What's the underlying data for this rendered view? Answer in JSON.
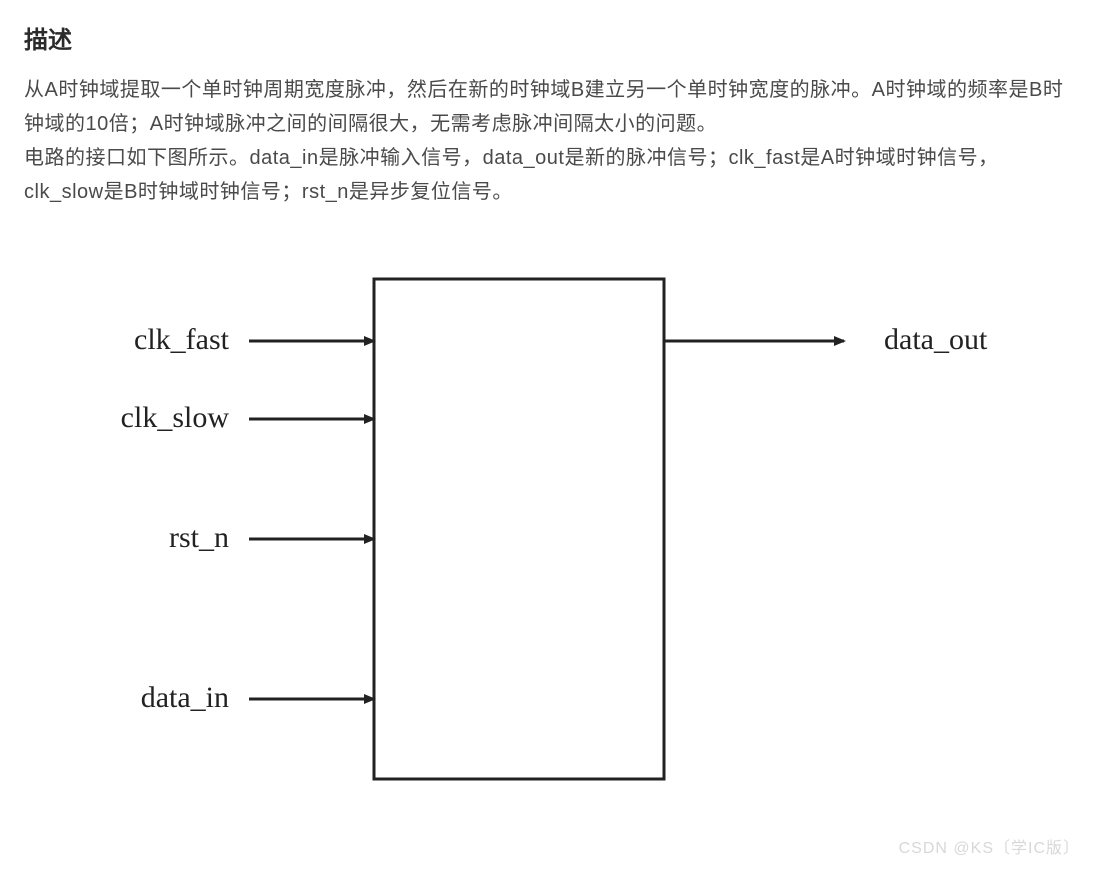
{
  "heading": "描述",
  "paragraph": "从A时钟域提取一个单时钟周期宽度脉冲，然后在新的时钟域B建立另一个单时钟宽度的脉冲。A时钟域的频率是B时钟域的10倍；A时钟域脉冲之间的间隔很大，无需考虑脉冲间隔太小的问题。\n电路的接口如下图所示。data_in是脉冲输入信号，data_out是新的脉冲信号；clk_fast是A时钟域时钟信号，clk_slow是B时钟域时钟信号；rst_n是异步复位信号。",
  "diagram": {
    "inputs": [
      {
        "label": "clk_fast"
      },
      {
        "label": "clk_slow"
      },
      {
        "label": "rst_n"
      },
      {
        "label": "data_in"
      }
    ],
    "outputs": [
      {
        "label": "data_out"
      }
    ]
  },
  "watermark": "CSDN @KS〔学IC版〕"
}
